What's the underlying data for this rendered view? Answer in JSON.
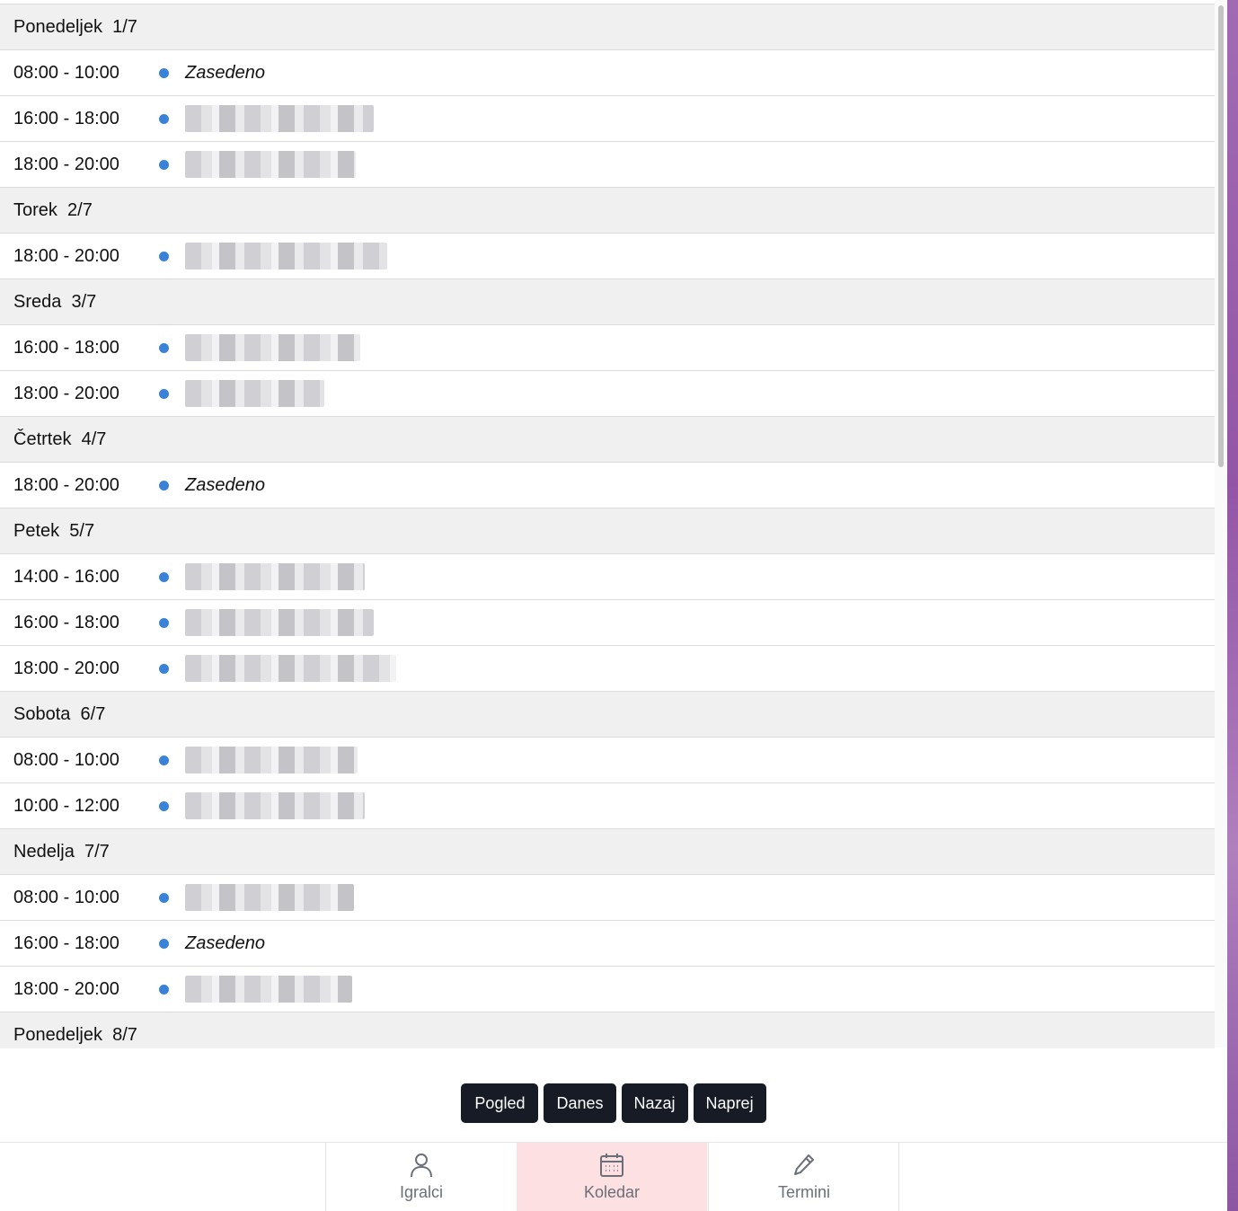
{
  "accent": {
    "dot": "#3a82d8",
    "nav_active_bg": "#fde0e2",
    "button_bg": "#161b26"
  },
  "agenda": [
    {
      "day": "Ponedeljek",
      "date": "1/7",
      "events": [
        {
          "time": "08:00 - 10:00",
          "title": "Zasedeno"
        },
        {
          "time": "16:00 - 18:00",
          "title": null
        },
        {
          "time": "18:00 - 20:00",
          "title": null
        }
      ]
    },
    {
      "day": "Torek",
      "date": "2/7",
      "events": [
        {
          "time": "18:00 - 20:00",
          "title": null
        }
      ]
    },
    {
      "day": "Sreda",
      "date": "3/7",
      "events": [
        {
          "time": "16:00 - 18:00",
          "title": null
        },
        {
          "time": "18:00 - 20:00",
          "title": null
        }
      ]
    },
    {
      "day": "Četrtek",
      "date": "4/7",
      "events": [
        {
          "time": "18:00 - 20:00",
          "title": "Zasedeno"
        }
      ]
    },
    {
      "day": "Petek",
      "date": "5/7",
      "events": [
        {
          "time": "14:00 - 16:00",
          "title": null
        },
        {
          "time": "16:00 - 18:00",
          "title": null
        },
        {
          "time": "18:00 - 20:00",
          "title": null
        }
      ]
    },
    {
      "day": "Sobota",
      "date": "6/7",
      "events": [
        {
          "time": "08:00 - 10:00",
          "title": null
        },
        {
          "time": "10:00 - 12:00",
          "title": null
        }
      ]
    },
    {
      "day": "Nedelja",
      "date": "7/7",
      "events": [
        {
          "time": "08:00 - 10:00",
          "title": null
        },
        {
          "time": "16:00 - 18:00",
          "title": "Zasedeno"
        },
        {
          "time": "18:00 - 20:00",
          "title": null
        }
      ]
    },
    {
      "day": "Ponedeljek",
      "date": "8/7",
      "events": []
    }
  ],
  "toolbar": {
    "view_label": "Pogled",
    "today_label": "Danes",
    "back_label": "Nazaj",
    "next_label": "Naprej"
  },
  "nav": [
    {
      "label": "Igralci",
      "icon": "user-icon",
      "active": false
    },
    {
      "label": "Koledar",
      "icon": "calendar-icon",
      "active": true
    },
    {
      "label": "Termini",
      "icon": "pencil-icon",
      "active": false
    }
  ]
}
